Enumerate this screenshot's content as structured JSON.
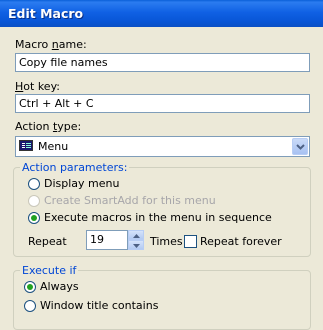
{
  "window": {
    "title": "Edit Macro"
  },
  "macro_name": {
    "label_pre": "Macro ",
    "label_u": "n",
    "label_post": "ame:",
    "value": "Copy file names"
  },
  "hot_key": {
    "label_u": "H",
    "label_post": "ot key:",
    "value": "Ctrl + Alt + C"
  },
  "action_type": {
    "label_pre": "Action ",
    "label_u": "t",
    "label_post": "ype:",
    "value": "Menu",
    "icon": "menu-icon"
  },
  "action_parameters": {
    "legend": "Action parameters:",
    "display_menu": "Display menu",
    "create_smartadd": "Create SmartAdd for this menu",
    "execute_macros": "Execute macros in the menu in sequence",
    "selected": "execute_macros",
    "repeat_label": "Repeat",
    "repeat_value": "19",
    "times_label": "Times",
    "repeat_forever": "Repeat forever",
    "repeat_forever_checked": false
  },
  "execute_if": {
    "legend": "Execute if",
    "always": "Always",
    "window_title_contains": "Window title contains",
    "selected": "always"
  },
  "colors": {
    "titlebar": "#0a5fd8",
    "group_legend": "#0046d5",
    "radio_selected": "#21a121",
    "dialog_bg": "#ece9d8"
  }
}
